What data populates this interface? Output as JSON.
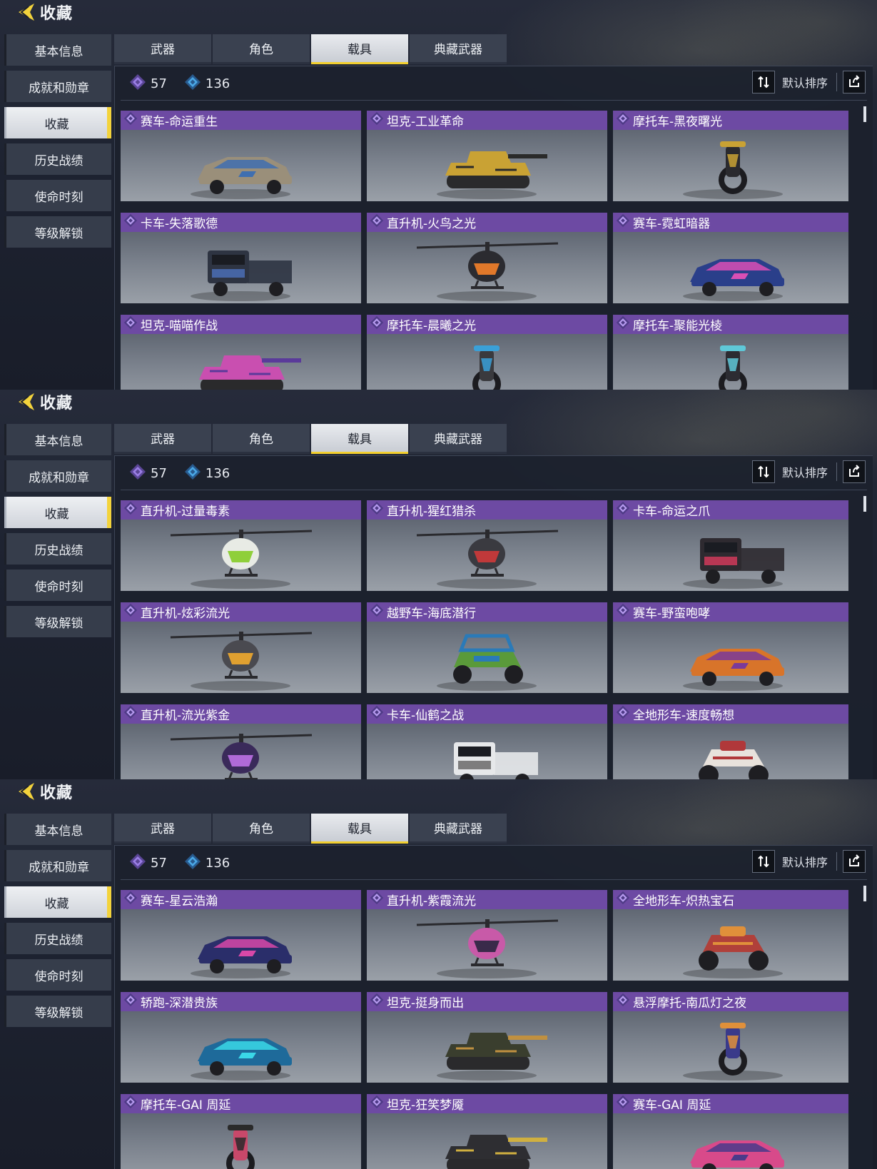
{
  "panels": [
    {
      "title": "收藏",
      "sidebar": [
        "基本信息",
        "成就和勋章",
        "收藏",
        "历史战绩",
        "使命时刻",
        "等级解锁"
      ],
      "active_sidebar": 2,
      "tabs": [
        "武器",
        "角色",
        "载具",
        "典藏武器"
      ],
      "active_tab": 2,
      "stats": {
        "purple": "57",
        "blue": "136"
      },
      "sort_label": "默认排序",
      "cards": [
        {
          "name": "赛车-命运重生",
          "shape": "car",
          "color": "#9a8f7a",
          "accent": "#3f6fb0"
        },
        {
          "name": "坦克-工业革命",
          "shape": "tank",
          "color": "#c9a234",
          "accent": "#2a2a2a"
        },
        {
          "name": "摩托车-黑夜曙光",
          "shape": "moto",
          "color": "#2a2a2e",
          "accent": "#c9a234"
        },
        {
          "name": "卡车-失落歌德",
          "shape": "truck",
          "color": "#2e3442",
          "accent": "#4a6fb5"
        },
        {
          "name": "直升机-火鸟之光",
          "shape": "heli",
          "color": "#2b2b30",
          "accent": "#e0782a"
        },
        {
          "name": "赛车-霓虹暗器",
          "shape": "car",
          "color": "#2a3f8a",
          "accent": "#d94fb5"
        },
        {
          "name": "坦克-喵喵作战",
          "shape": "tank",
          "color": "#c94fb0",
          "accent": "#5a3a9a"
        },
        {
          "name": "摩托车-晨曦之光",
          "shape": "moto",
          "color": "#3a3a3e",
          "accent": "#3aa0d8"
        },
        {
          "name": "摩托车-聚能光棱",
          "shape": "moto",
          "color": "#2c2c32",
          "accent": "#5fc8d8"
        }
      ]
    },
    {
      "title": "收藏",
      "sidebar": [
        "基本信息",
        "成就和勋章",
        "收藏",
        "历史战绩",
        "使命时刻",
        "等级解锁"
      ],
      "active_sidebar": 2,
      "tabs": [
        "武器",
        "角色",
        "载具",
        "典藏武器"
      ],
      "active_tab": 2,
      "stats": {
        "purple": "57",
        "blue": "136"
      },
      "sort_label": "默认排序",
      "cards": [
        {
          "name": "直升机-过量毒素",
          "shape": "heli",
          "color": "#e8ebe5",
          "accent": "#8fcf3a"
        },
        {
          "name": "直升机-猩红猎杀",
          "shape": "heli",
          "color": "#3a3a40",
          "accent": "#c0393a"
        },
        {
          "name": "卡车-命运之爪",
          "shape": "truck",
          "color": "#2e2a30",
          "accent": "#d03a5a"
        },
        {
          "name": "直升机-炫彩流光",
          "shape": "heli",
          "color": "#4a4a50",
          "accent": "#e0a030"
        },
        {
          "name": "越野车-海底潜行",
          "shape": "buggy",
          "color": "#5a9a3a",
          "accent": "#2a7ab8"
        },
        {
          "name": "赛车-野蛮咆哮",
          "shape": "car",
          "color": "#d8742a",
          "accent": "#7a3a9a"
        },
        {
          "name": "直升机-流光紫金",
          "shape": "heli",
          "color": "#3a2a5a",
          "accent": "#b06ad8"
        },
        {
          "name": "卡车-仙鹤之战",
          "shape": "truck",
          "color": "#e6e8ea",
          "accent": "#6a6a6a"
        },
        {
          "name": "全地形车-速度畅想",
          "shape": "atv",
          "color": "#e8e2dc",
          "accent": "#b0383a"
        }
      ]
    },
    {
      "title": "收藏",
      "sidebar": [
        "基本信息",
        "成就和勋章",
        "收藏",
        "历史战绩",
        "使命时刻",
        "等级解锁"
      ],
      "active_sidebar": 2,
      "tabs": [
        "武器",
        "角色",
        "载具",
        "典藏武器"
      ],
      "active_tab": 2,
      "stats": {
        "purple": "57",
        "blue": "136"
      },
      "sort_label": "默认排序",
      "cards": [
        {
          "name": "赛车-星云浩瀚",
          "shape": "car",
          "color": "#2a2e6a",
          "accent": "#d848a8"
        },
        {
          "name": "直升机-紫霞流光",
          "shape": "heli",
          "color": "#c85aa8",
          "accent": "#3a2a4a"
        },
        {
          "name": "全地形车-炽热宝石",
          "shape": "atv",
          "color": "#b0403a",
          "accent": "#e0903a"
        },
        {
          "name": "轿跑-深潜贵族",
          "shape": "car",
          "color": "#1e6a9a",
          "accent": "#3ad8e8"
        },
        {
          "name": "坦克-挺身而出",
          "shape": "tank",
          "color": "#3a3e2e",
          "accent": "#c09040"
        },
        {
          "name": "悬浮摩托-南瓜灯之夜",
          "shape": "moto",
          "color": "#3a3a8a",
          "accent": "#e0903a"
        },
        {
          "name": "摩托车-GAI 周延",
          "shape": "moto",
          "color": "#c8486a",
          "accent": "#2a2a2a"
        },
        {
          "name": "坦克-狂笑梦魇",
          "shape": "tank",
          "color": "#2e2e32",
          "accent": "#d0b040"
        },
        {
          "name": "赛车-GAI 周延",
          "shape": "car",
          "color": "#d84a8a",
          "accent": "#4a3a8a"
        }
      ]
    }
  ],
  "icons": {
    "back": "back-arrow-icon",
    "purple_gem": "purple-diamond-icon",
    "blue_gem": "blue-diamond-icon",
    "sort": "sort-arrows-icon",
    "share": "share-icon",
    "rarity": "rarity-diamond-icon"
  },
  "colors": {
    "accent_yellow": "#f3d33c",
    "card_header": "#6d4aa3",
    "purple_gem": "#9b7fe6",
    "blue_gem": "#4aa8e6"
  }
}
